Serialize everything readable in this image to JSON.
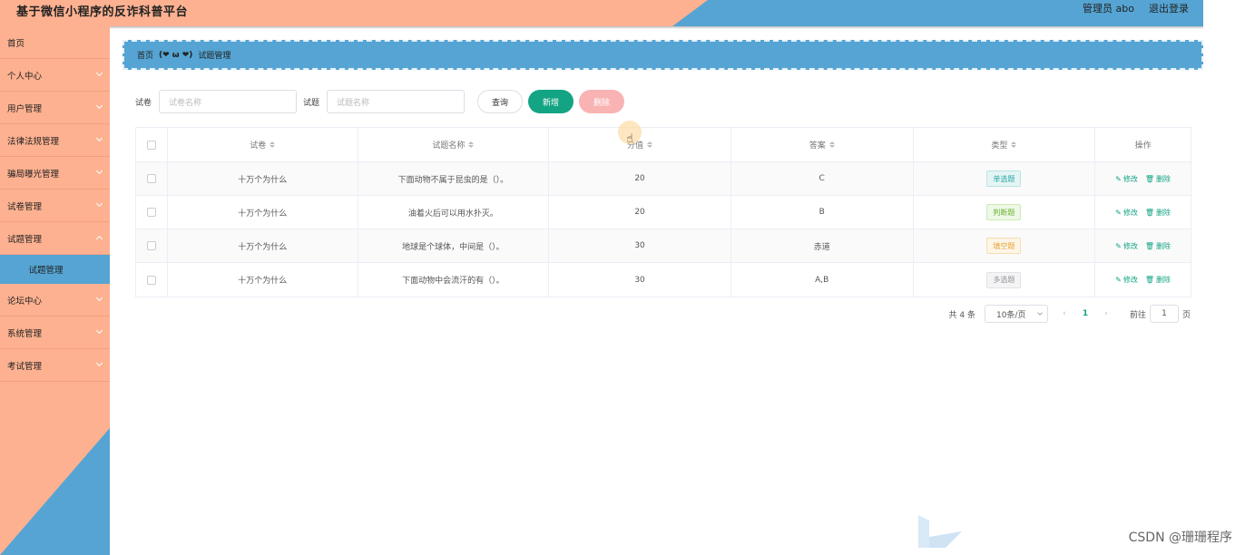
{
  "header": {
    "title": "基于微信小程序的反诈科普平台",
    "admin_label": "管理员 abo",
    "logout_label": "退出登录"
  },
  "sidebar": {
    "items": [
      {
        "label": "首页"
      },
      {
        "label": "个人中心"
      },
      {
        "label": "用户管理"
      },
      {
        "label": "法律法规管理"
      },
      {
        "label": "骗局曝光管理"
      },
      {
        "label": "试卷管理"
      },
      {
        "label": "试题管理"
      },
      {
        "label": "论坛中心"
      },
      {
        "label": "系统管理"
      },
      {
        "label": "考试管理"
      }
    ],
    "submenu_active": "试题管理"
  },
  "breadcrumb": {
    "home": "首页",
    "separator": "(❤ ω ❤)",
    "current": "试题管理"
  },
  "search": {
    "paper_label": "试卷",
    "paper_placeholder": "试卷名称",
    "question_label": "试题",
    "question_placeholder": "试题名称",
    "query_btn": "查询",
    "add_btn": "新增",
    "delete_btn": "删除"
  },
  "table": {
    "headers": [
      "试卷",
      "试题名称",
      "分值",
      "答案",
      "类型",
      "操作"
    ],
    "rows": [
      {
        "paper": "十万个为什么",
        "question": "下面动物不属于昆虫的是（）。",
        "score": "20",
        "answer": "C",
        "type": "单选题"
      },
      {
        "paper": "十万个为什么",
        "question": "油着火后可以用水扑灭。",
        "score": "20",
        "answer": "B",
        "type": "判断题"
      },
      {
        "paper": "十万个为什么",
        "question": "地球是个球体，中间是（）。",
        "score": "30",
        "answer": "赤道",
        "type": "填空题"
      },
      {
        "paper": "十万个为什么",
        "question": "下面动物中会流汗的有（）。",
        "score": "30",
        "answer": "A,B",
        "type": "多选题"
      }
    ],
    "edit_label": "修改",
    "delete_label": "删除"
  },
  "pagination": {
    "total": "共 4 条",
    "page_size": "10条/页",
    "current_page": "1",
    "goto_label": "前往",
    "goto_value": "1",
    "page_unit": "页"
  },
  "watermark": "CSDN @珊珊程序",
  "colors": {
    "orange": "#fdb190",
    "blue": "#55a4d3",
    "green": "#13a484",
    "pink": "#f9b3b3"
  }
}
